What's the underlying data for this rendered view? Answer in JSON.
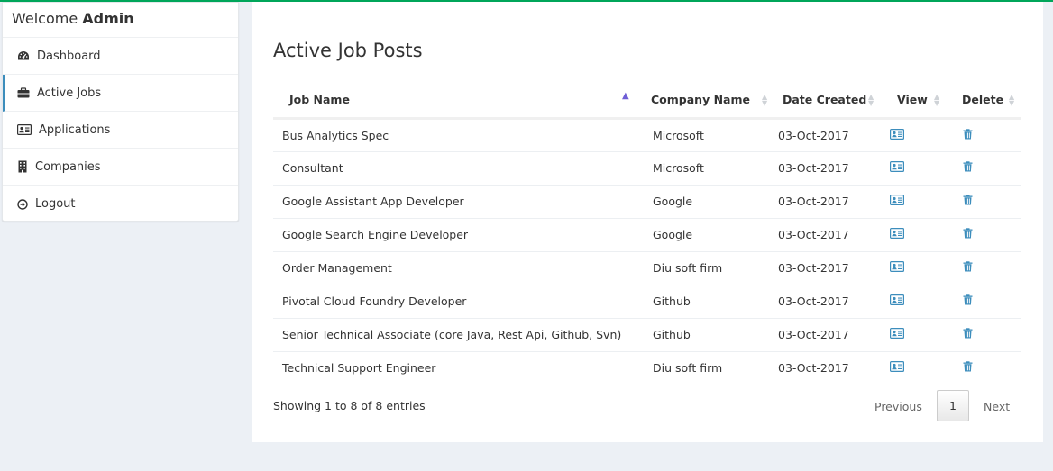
{
  "sidebar": {
    "welcome_prefix": "Welcome",
    "welcome_user": "Admin",
    "items": [
      {
        "label": "Dashboard",
        "icon": "dashboard-icon"
      },
      {
        "label": "Active Jobs",
        "icon": "briefcase-icon",
        "active": true
      },
      {
        "label": "Applications",
        "icon": "address-card-icon"
      },
      {
        "label": "Companies",
        "icon": "building-icon"
      },
      {
        "label": "Logout",
        "icon": "sign-out-icon"
      }
    ]
  },
  "main": {
    "title": "Active Job Posts",
    "columns": [
      "Job Name",
      "Company Name",
      "Date Created",
      "View",
      "Delete"
    ],
    "rows": [
      {
        "job": "Bus Analytics Spec",
        "company": "Microsoft",
        "date": "03-Oct-2017"
      },
      {
        "job": "Consultant",
        "company": "Microsoft",
        "date": "03-Oct-2017"
      },
      {
        "job": "Google Assistant App Developer",
        "company": "Google",
        "date": "03-Oct-2017"
      },
      {
        "job": "Google Search Engine Developer",
        "company": "Google",
        "date": "03-Oct-2017"
      },
      {
        "job": "Order Management",
        "company": "Diu soft firm",
        "date": "03-Oct-2017"
      },
      {
        "job": "Pivotal Cloud Foundry Developer",
        "company": "Github",
        "date": "03-Oct-2017"
      },
      {
        "job": "Senior Technical Associate (core Java, Rest Api, Github, Svn)",
        "company": "Github",
        "date": "03-Oct-2017"
      },
      {
        "job": "Technical Support Engineer",
        "company": "Diu soft firm",
        "date": "03-Oct-2017"
      }
    ],
    "info": "Showing 1 to 8 of 8 entries",
    "pagination": {
      "previous": "Previous",
      "page": "1",
      "next": "Next"
    }
  },
  "colors": {
    "accent": "#3c8dbc",
    "top_bar": "#00a65a",
    "sort_active": "#6f5fd6"
  }
}
